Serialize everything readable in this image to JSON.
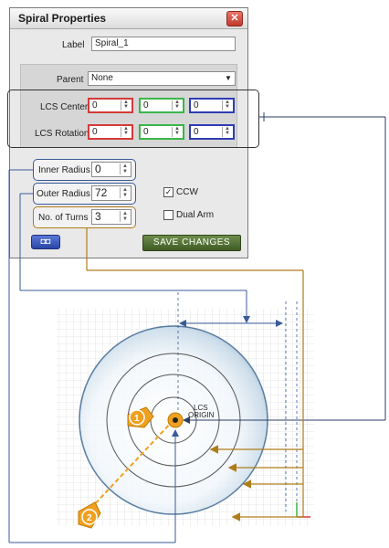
{
  "dialog": {
    "title": "Spiral Properties",
    "close": "✕",
    "label_caption": "Label",
    "label_value": "Spiral_1",
    "parent_caption": "Parent",
    "parent_value": "None",
    "lcs_center_caption": "LCS Center",
    "lcs_center_values": [
      "0",
      "0",
      "0"
    ],
    "lcs_rotation_caption": "LCS Rotation",
    "lcs_rotation_values": [
      "0",
      "0",
      "0"
    ],
    "inner_radius_caption": "Inner Radius",
    "inner_radius_value": "0",
    "outer_radius_caption": "Outer Radius",
    "outer_radius_value": "72",
    "turns_caption": "No. of Turns",
    "turns_value": "3",
    "ccw_label": "CCW",
    "ccw_checked": "✓",
    "dual_arm_label": "Dual Arm",
    "save_label": "SAVE CHANGES",
    "glasses_label": "◘◘"
  },
  "diagram": {
    "lcs_origin_label_line1": "LCS",
    "lcs_origin_label_line2": "ORIGIN",
    "marker1": "1",
    "marker2": "2"
  },
  "colors": {
    "red": "#d23a3a",
    "green": "#3bb54a",
    "blue": "#2f3db5",
    "callout_blue": "#3a5a9a",
    "callout_orange": "#b07c1a",
    "save_green": "#4e6e32"
  }
}
